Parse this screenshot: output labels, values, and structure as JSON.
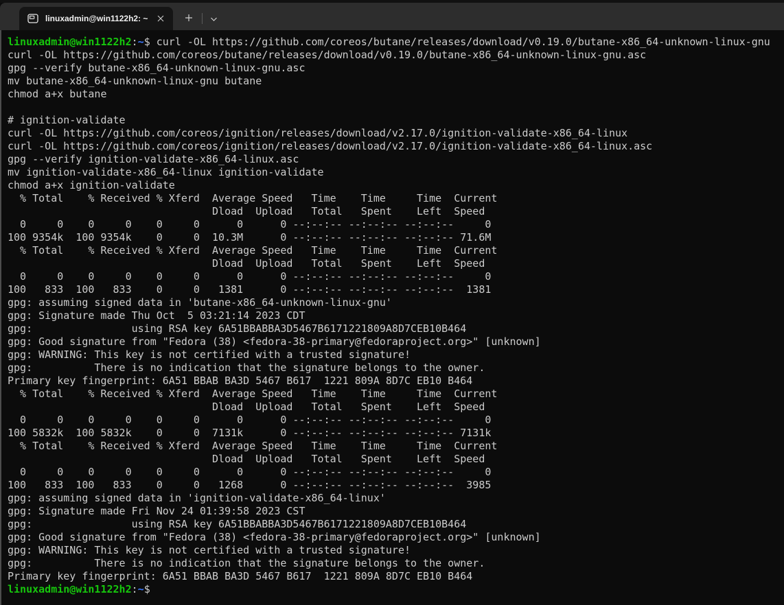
{
  "window": {
    "tab_title": "linuxadmin@win1122h2: ~",
    "icons": {
      "tab_icon": "command-prompt-icon",
      "close": "close-icon",
      "new_tab": "plus-icon",
      "dropdown": "chevron-down-icon"
    }
  },
  "palette": {
    "terminal_bg": "#0c0c0c",
    "terminal_fg": "#cccccc",
    "prompt_green": "#16c60c",
    "prompt_blue": "#3b78ff",
    "tabbar_bg": "#2d2d2d",
    "active_tab_bg": "#151515"
  },
  "terminal": {
    "lines": [
      [
        [
          "green",
          "linuxadmin@win1122h2"
        ],
        [
          "fg",
          ":"
        ],
        [
          "blue",
          "~"
        ],
        [
          "fg",
          "$ curl -OL https://github.com/coreos/butane/releases/download/v0.19.0/butane-x86_64-unknown-linux-gnu"
        ]
      ],
      [
        [
          "fg",
          "curl -OL https://github.com/coreos/butane/releases/download/v0.19.0/butane-x86_64-unknown-linux-gnu.asc"
        ]
      ],
      [
        [
          "fg",
          "gpg --verify butane-x86_64-unknown-linux-gnu.asc"
        ]
      ],
      [
        [
          "fg",
          "mv butane-x86_64-unknown-linux-gnu butane"
        ]
      ],
      [
        [
          "fg",
          "chmod a+x butane"
        ]
      ],
      [
        [
          "fg",
          ""
        ]
      ],
      [
        [
          "fg",
          "# ignition-validate"
        ]
      ],
      [
        [
          "fg",
          "curl -OL https://github.com/coreos/ignition/releases/download/v2.17.0/ignition-validate-x86_64-linux"
        ]
      ],
      [
        [
          "fg",
          "curl -OL https://github.com/coreos/ignition/releases/download/v2.17.0/ignition-validate-x86_64-linux.asc"
        ]
      ],
      [
        [
          "fg",
          "gpg --verify ignition-validate-x86_64-linux.asc"
        ]
      ],
      [
        [
          "fg",
          "mv ignition-validate-x86_64-linux ignition-validate"
        ]
      ],
      [
        [
          "fg",
          "chmod a+x ignition-validate"
        ]
      ],
      [
        [
          "fg",
          "  % Total    % Received % Xferd  Average Speed   Time    Time     Time  Current"
        ]
      ],
      [
        [
          "fg",
          "                                 Dload  Upload   Total   Spent    Left  Speed"
        ]
      ],
      [
        [
          "fg",
          "  0     0    0     0    0     0      0      0 --:--:-- --:--:-- --:--:--     0"
        ]
      ],
      [
        [
          "fg",
          "100 9354k  100 9354k    0     0  10.3M      0 --:--:-- --:--:-- --:--:-- 71.6M"
        ]
      ],
      [
        [
          "fg",
          "  % Total    % Received % Xferd  Average Speed   Time    Time     Time  Current"
        ]
      ],
      [
        [
          "fg",
          "                                 Dload  Upload   Total   Spent    Left  Speed"
        ]
      ],
      [
        [
          "fg",
          "  0     0    0     0    0     0      0      0 --:--:-- --:--:-- --:--:--     0"
        ]
      ],
      [
        [
          "fg",
          "100   833  100   833    0     0   1381      0 --:--:-- --:--:-- --:--:--  1381"
        ]
      ],
      [
        [
          "fg",
          "gpg: assuming signed data in 'butane-x86_64-unknown-linux-gnu'"
        ]
      ],
      [
        [
          "fg",
          "gpg: Signature made Thu Oct  5 03:21:14 2023 CDT"
        ]
      ],
      [
        [
          "fg",
          "gpg:                using RSA key 6A51BBABBA3D5467B6171221809A8D7CEB10B464"
        ]
      ],
      [
        [
          "fg",
          "gpg: Good signature from \"Fedora (38) <fedora-38-primary@fedoraproject.org>\" [unknown]"
        ]
      ],
      [
        [
          "fg",
          "gpg: WARNING: This key is not certified with a trusted signature!"
        ]
      ],
      [
        [
          "fg",
          "gpg:          There is no indication that the signature belongs to the owner."
        ]
      ],
      [
        [
          "fg",
          "Primary key fingerprint: 6A51 BBAB BA3D 5467 B617  1221 809A 8D7C EB10 B464"
        ]
      ],
      [
        [
          "fg",
          "  % Total    % Received % Xferd  Average Speed   Time    Time     Time  Current"
        ]
      ],
      [
        [
          "fg",
          "                                 Dload  Upload   Total   Spent    Left  Speed"
        ]
      ],
      [
        [
          "fg",
          "  0     0    0     0    0     0      0      0 --:--:-- --:--:-- --:--:--     0"
        ]
      ],
      [
        [
          "fg",
          "100 5832k  100 5832k    0     0  7131k      0 --:--:-- --:--:-- --:--:-- 7131k"
        ]
      ],
      [
        [
          "fg",
          "  % Total    % Received % Xferd  Average Speed   Time    Time     Time  Current"
        ]
      ],
      [
        [
          "fg",
          "                                 Dload  Upload   Total   Spent    Left  Speed"
        ]
      ],
      [
        [
          "fg",
          "  0     0    0     0    0     0      0      0 --:--:-- --:--:-- --:--:--     0"
        ]
      ],
      [
        [
          "fg",
          "100   833  100   833    0     0   1268      0 --:--:-- --:--:-- --:--:--  3985"
        ]
      ],
      [
        [
          "fg",
          "gpg: assuming signed data in 'ignition-validate-x86_64-linux'"
        ]
      ],
      [
        [
          "fg",
          "gpg: Signature made Fri Nov 24 01:39:58 2023 CST"
        ]
      ],
      [
        [
          "fg",
          "gpg:                using RSA key 6A51BBABBA3D5467B6171221809A8D7CEB10B464"
        ]
      ],
      [
        [
          "fg",
          "gpg: Good signature from \"Fedora (38) <fedora-38-primary@fedoraproject.org>\" [unknown]"
        ]
      ],
      [
        [
          "fg",
          "gpg: WARNING: This key is not certified with a trusted signature!"
        ]
      ],
      [
        [
          "fg",
          "gpg:          There is no indication that the signature belongs to the owner."
        ]
      ],
      [
        [
          "fg",
          "Primary key fingerprint: 6A51 BBAB BA3D 5467 B617  1221 809A 8D7C EB10 B464"
        ]
      ],
      [
        [
          "green",
          "linuxadmin@win1122h2"
        ],
        [
          "fg",
          ":"
        ],
        [
          "blue",
          "~"
        ],
        [
          "fg",
          "$"
        ]
      ]
    ]
  }
}
